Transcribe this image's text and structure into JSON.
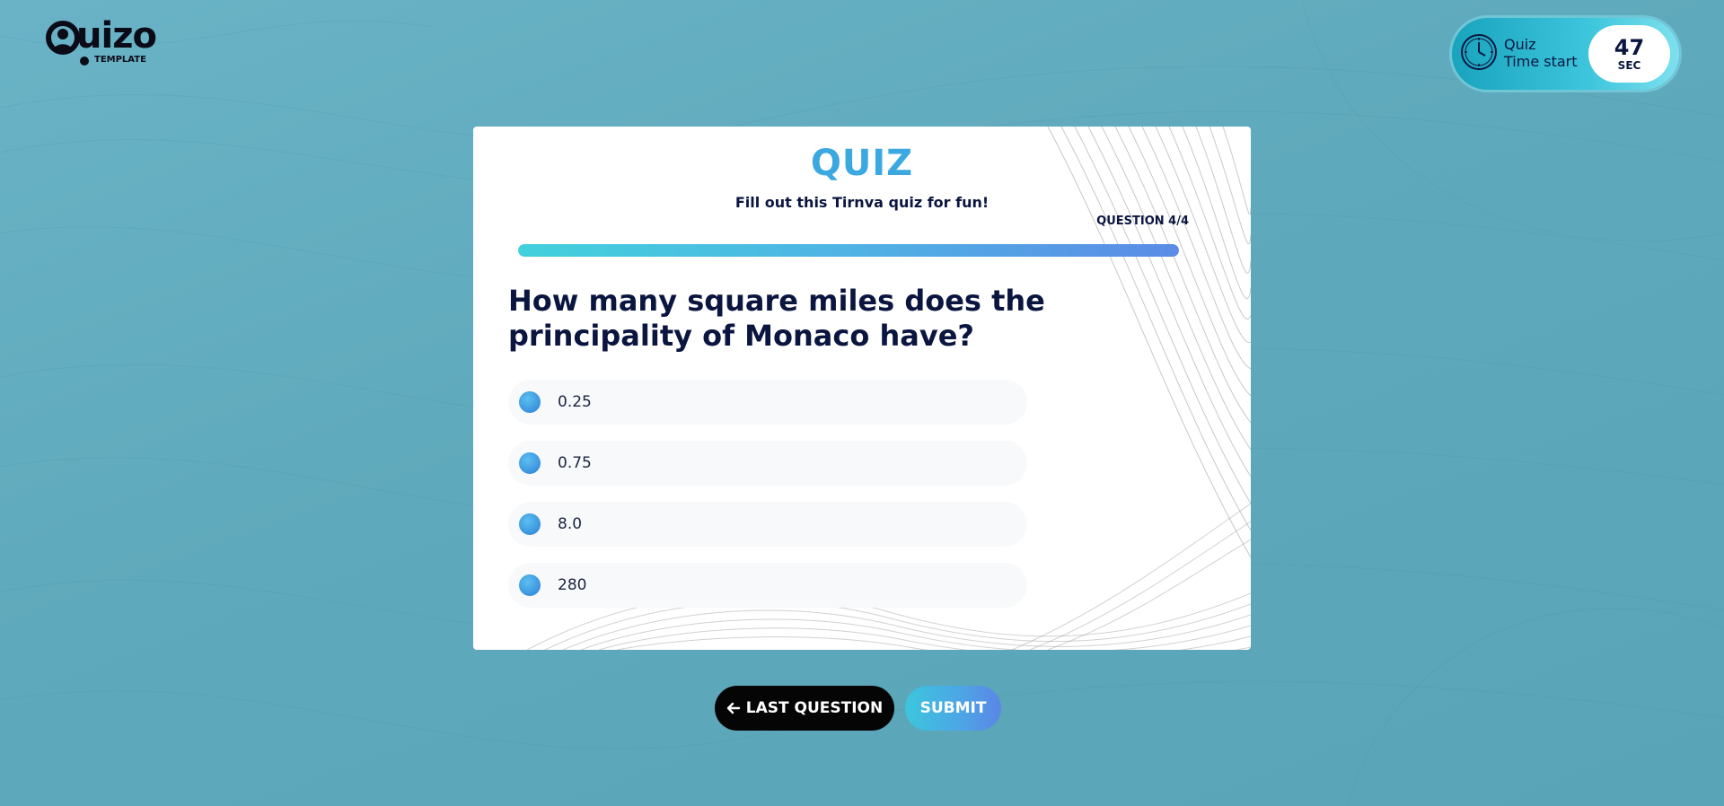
{
  "logo": {
    "text": "uizo",
    "subtext": "TEMPLATE"
  },
  "timer": {
    "icon": "clock-icon",
    "label_line1": "Quiz",
    "label_line2": "Time start",
    "value": "47",
    "unit": "SEC"
  },
  "quiz": {
    "title": "QUIZ",
    "subtitle": "Fill out this Tirnva quiz for fun!",
    "counter": "QUESTION 4/4",
    "progress": 1.0,
    "question": "How many square miles does the principality of Monaco have?",
    "options": [
      {
        "label": "0.25"
      },
      {
        "label": "0.75"
      },
      {
        "label": "8.0"
      },
      {
        "label": "280"
      }
    ]
  },
  "actions": {
    "back_label": "LAST QUESTION",
    "back_icon": "arrow-left-icon",
    "submit_label": "SUBMIT"
  },
  "colors": {
    "background": "#5fa9bc",
    "title_blue": "#3ba8e0",
    "navy": "#0b1640",
    "black_button": "#050505"
  }
}
